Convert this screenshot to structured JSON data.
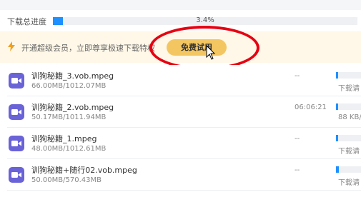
{
  "overall": {
    "label": "下载总进度",
    "percent_text": "3.4%",
    "progress": 0.034
  },
  "promo": {
    "text": "开通超级会员，立即尊享极速下载特权",
    "button_label": "免费试用",
    "highlight_color": "#e60012",
    "button_color": "#f4c662"
  },
  "files": [
    {
      "name": "训狗秘籍_3.vob.mpeg",
      "size": "66.00MB/1012.07MB",
      "time": "--",
      "status": "下载请",
      "progress": 0.065
    },
    {
      "name": "训狗秘籍_2.vob.mpeg",
      "size": "50.17MB/1011.94MB",
      "time": "06:06:21",
      "status": "88 KB/",
      "progress": 0.05
    },
    {
      "name": "训狗秘籍_1.mpeg",
      "size": "48.00MB/1012.61MB",
      "time": "--",
      "status": "下载请",
      "progress": 0.047
    },
    {
      "name": "训狗秘籍+随行02.vob.mpeg",
      "size": "50.00MB/570.43MB",
      "time": "--",
      "status": "下载请",
      "progress": 0.088
    }
  ],
  "colors": {
    "accent": "#1e90ff",
    "file_icon": "#6a63d8"
  },
  "icons": {
    "promo": "lightning-icon",
    "file": "video-file-icon",
    "cursor": "mouse-pointer-icon"
  }
}
